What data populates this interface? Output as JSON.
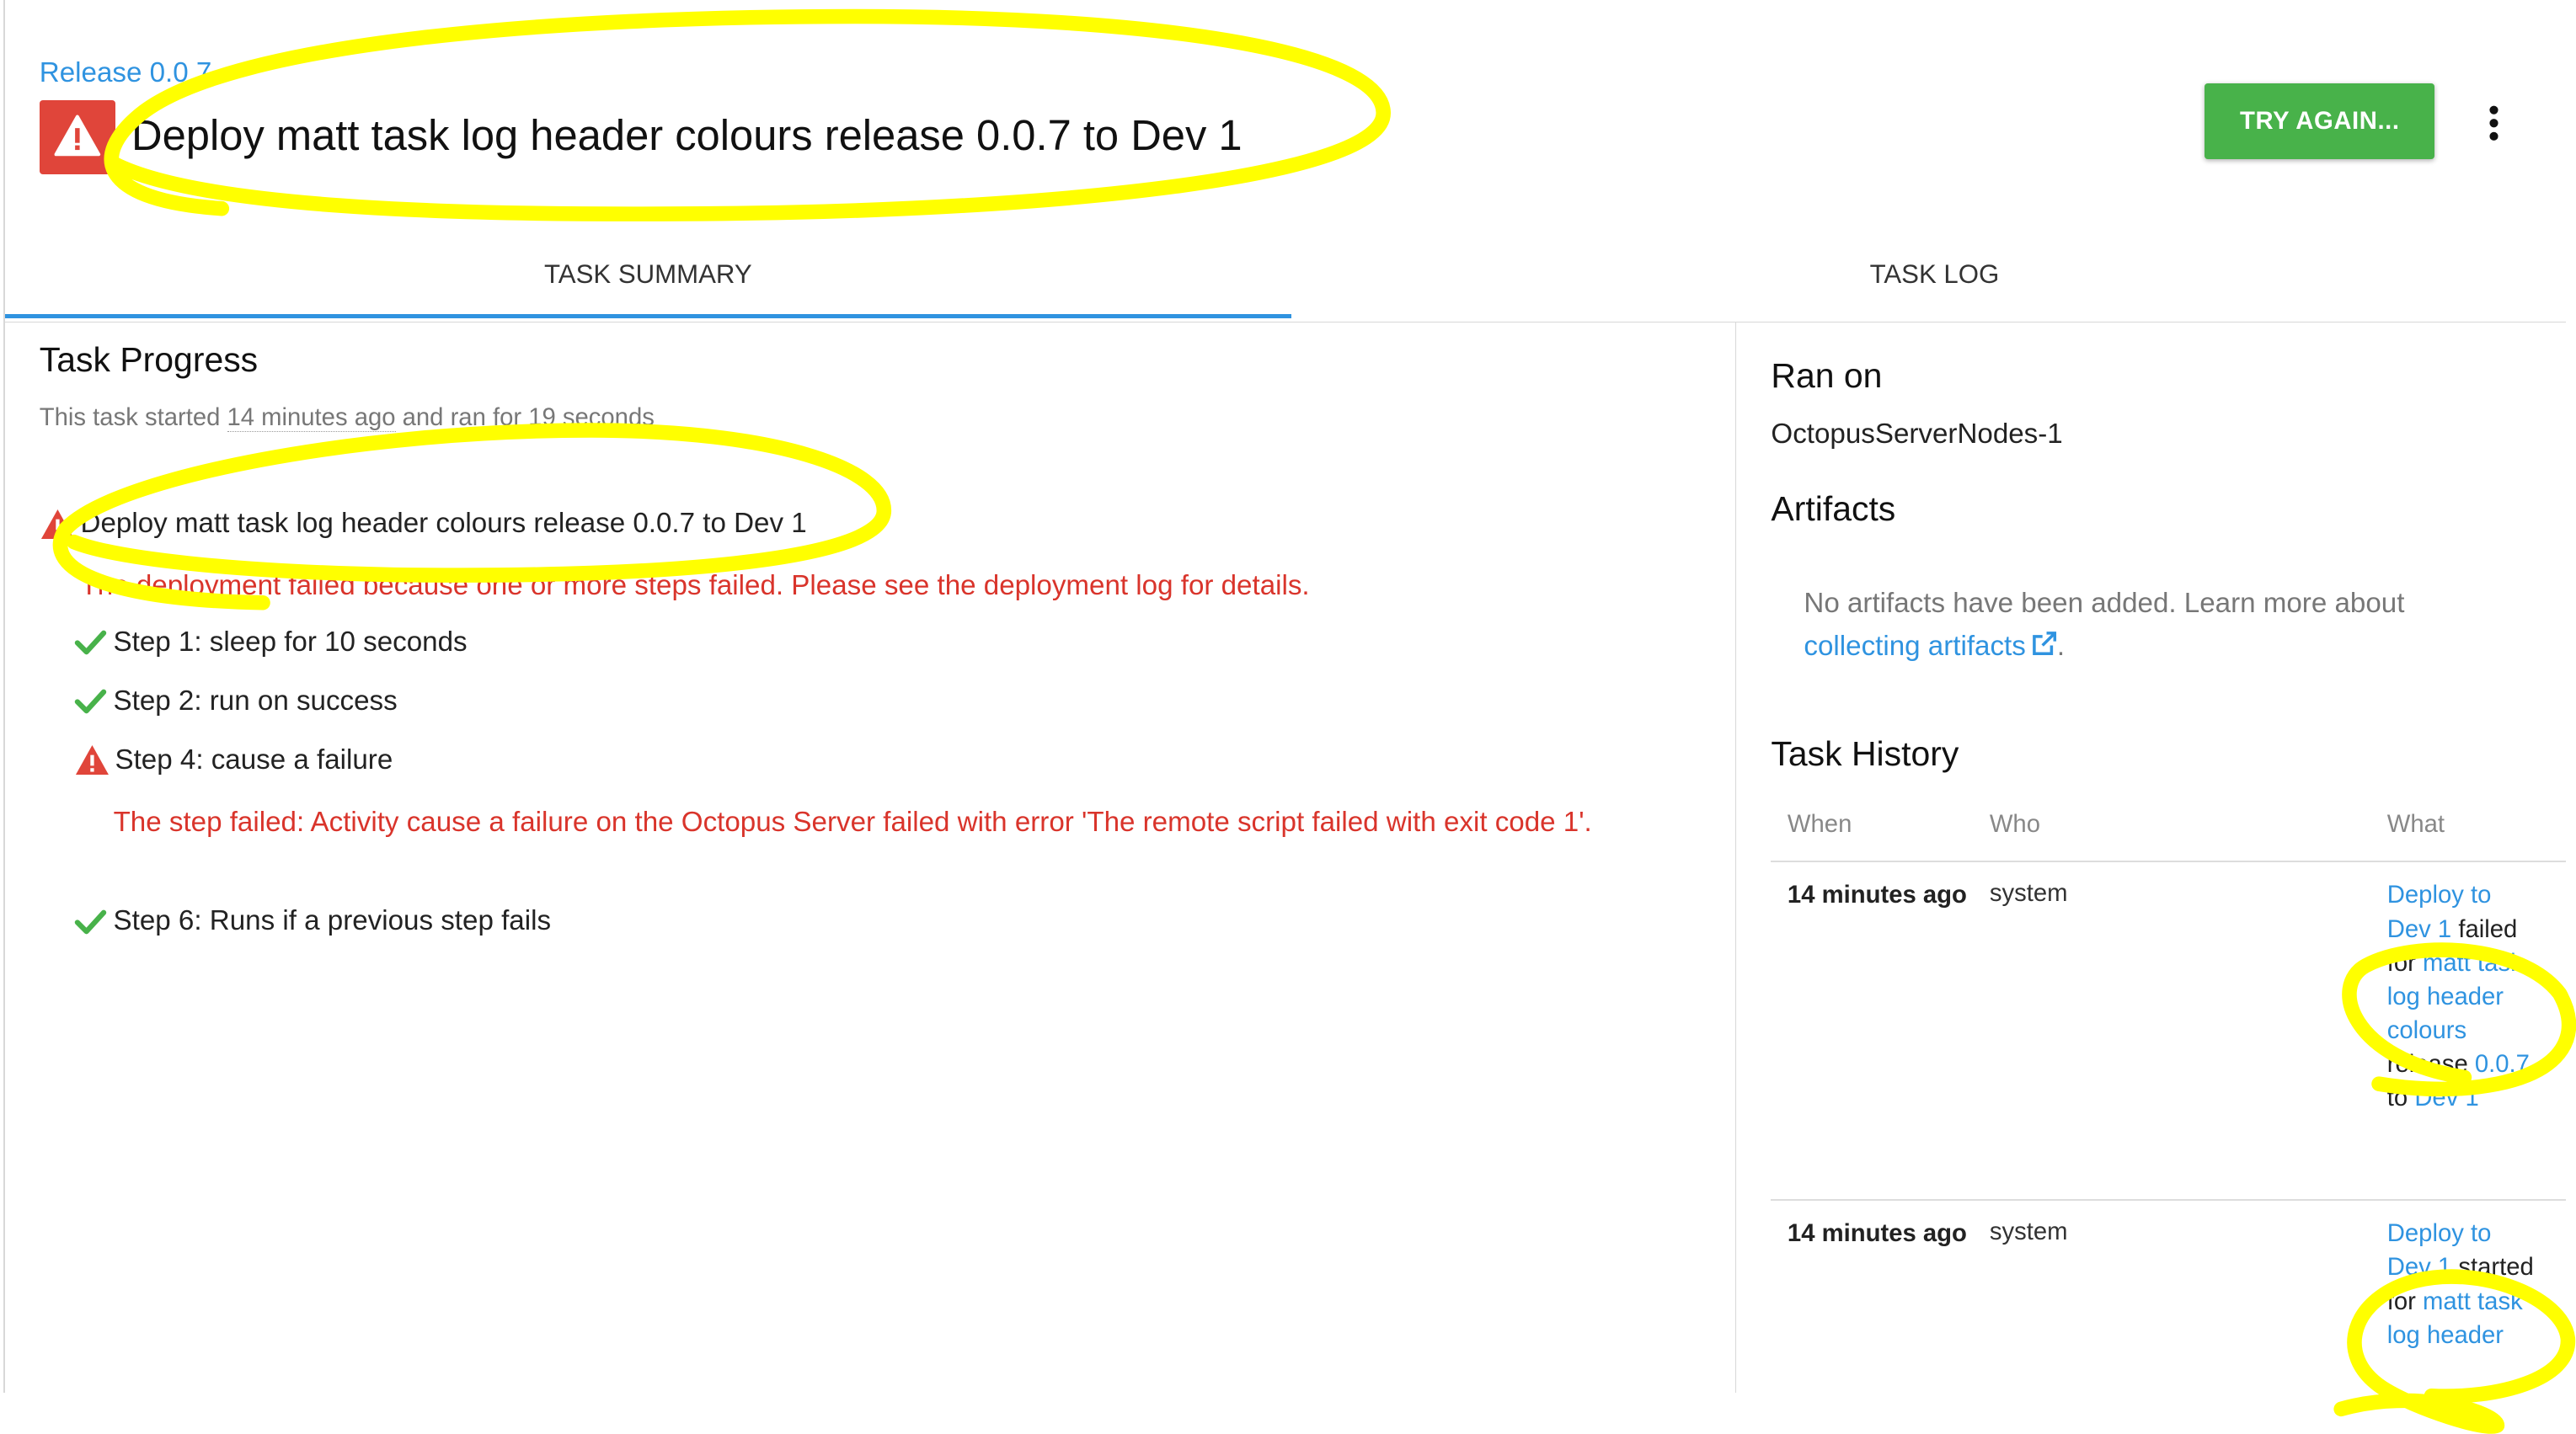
{
  "header": {
    "breadcrumb": "Release 0.0.7",
    "title": "Deploy matt task log header colours release 0.0.7 to Dev 1",
    "try_again_label": "TRY AGAIN...",
    "more_icon": "more-vert-icon",
    "status_icon": "warning-icon"
  },
  "tabs": [
    {
      "label": "TASK SUMMARY",
      "active": true
    },
    {
      "label": "TASK LOG",
      "active": false
    }
  ],
  "summary": {
    "title": "Task Progress",
    "started_prefix": "This task started ",
    "started_ago": "14 minutes ago",
    "started_middle": " and ran for ",
    "duration": "19 seconds",
    "task_name": "Deploy matt task log header colours release 0.0.7 to Dev 1",
    "task_error": "The deployment failed because one or more steps failed. Please see the deployment log for details.",
    "steps": [
      {
        "label": "Step 1: sleep for 10 seconds",
        "status": "success"
      },
      {
        "label": "Step 2: run on success",
        "status": "success"
      },
      {
        "label": "Step 4: cause a failure",
        "status": "failed",
        "error": "The step failed: Activity cause a failure on the Octopus Server failed with error 'The remote script failed with exit code 1'."
      },
      {
        "label": "Step 6: Runs if a previous step fails",
        "status": "success"
      }
    ]
  },
  "sidebar": {
    "ran_on_title": "Ran on",
    "ran_on_value": "OctopusServerNodes-1",
    "artifacts_title": "Artifacts",
    "artifacts_msg": "No artifacts have been added. Learn more about",
    "artifacts_link": "collecting artifacts",
    "artifacts_period": ".",
    "history_title": "Task History",
    "history_headers": {
      "when": "When",
      "who": "Who",
      "what": "What"
    },
    "history": [
      {
        "when": "14 minutes ago",
        "who": "system",
        "what": {
          "link1": "Deploy to Dev 1",
          "text1": " failed for ",
          "link2": "matt task log header colours",
          "text2": " release ",
          "link3": "0.0.7",
          "text3": " to ",
          "link4": "Dev 1"
        }
      },
      {
        "when": "14 minutes ago",
        "who": "system",
        "what": {
          "link1": "Deploy to Dev 1",
          "text1": " started for ",
          "link2": "matt task log header"
        }
      }
    ]
  },
  "colors": {
    "accent": "#2f93e0",
    "success": "#48b24a",
    "error": "#d9342b",
    "annotation": "#ffff00"
  }
}
